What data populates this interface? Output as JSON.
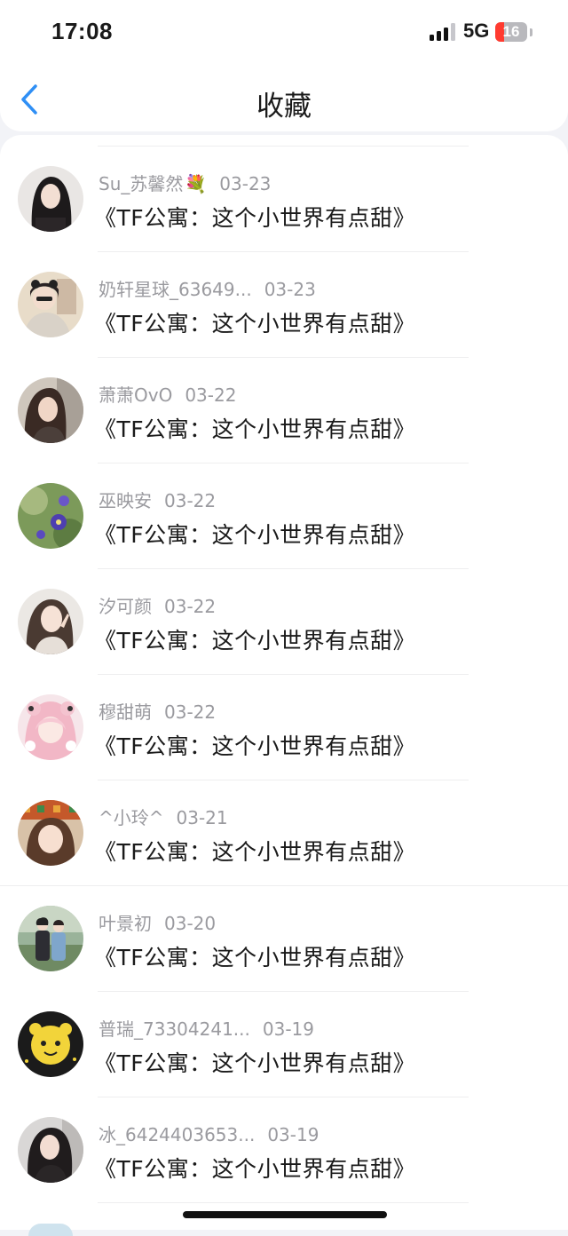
{
  "status_bar": {
    "time": "17:08",
    "network": "5G",
    "battery": "16"
  },
  "header": {
    "title": "收藏"
  },
  "items": [
    {
      "user": "Su_苏馨然",
      "date": "03-23",
      "title": "《TF公寓：这个小世界有点甜》"
    },
    {
      "user": "奶轩星球_63649...",
      "date": "03-23",
      "title": "《TF公寓：这个小世界有点甜》"
    },
    {
      "user": "萧萧OvO",
      "date": "03-22",
      "title": "《TF公寓：这个小世界有点甜》"
    },
    {
      "user": "巫映安",
      "date": "03-22",
      "title": "《TF公寓：这个小世界有点甜》"
    },
    {
      "user": "汐可颜",
      "date": "03-22",
      "title": "《TF公寓：这个小世界有点甜》"
    },
    {
      "user": "穆甜萌",
      "date": "03-22",
      "title": "《TF公寓：这个小世界有点甜》"
    },
    {
      "user": "^小玲^",
      "date": "03-21",
      "title": "《TF公寓：这个小世界有点甜》"
    },
    {
      "user": "叶景初",
      "date": "03-20",
      "title": "《TF公寓：这个小世界有点甜》"
    },
    {
      "user": "普瑞_73304241...",
      "date": "03-19",
      "title": "《TF公寓：这个小世界有点甜》"
    },
    {
      "user": "冰_6424403653...",
      "date": "03-19",
      "title": "《TF公寓：这个小世界有点甜》"
    }
  ],
  "colors": {
    "accent": "#2f8ff5",
    "muted_text": "#9a9a9f",
    "battery_low": "#ff3b30"
  }
}
